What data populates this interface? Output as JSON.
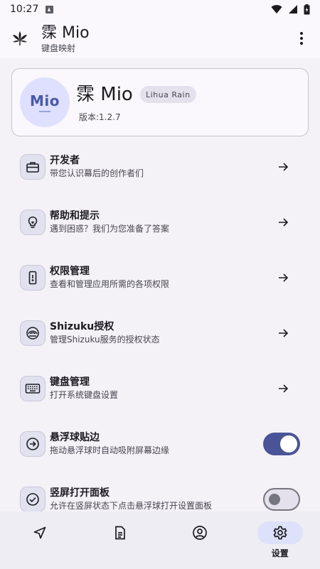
{
  "status_bar": {
    "time": "10:27"
  },
  "app_bar": {
    "title": "霂 Mio",
    "subtitle": "键盘映射"
  },
  "about": {
    "avatar_text": "Mio",
    "name": "霂 Mio",
    "author": "Lihua Rain",
    "version": "版本:1.2.7"
  },
  "settings": {
    "items": [
      {
        "label": "开发者",
        "desc": "带您认识幕后的创作者们",
        "icon": "briefcase-icon",
        "trailing": "arrow"
      },
      {
        "label": "帮助和提示",
        "desc": "遇到困惑？我们为您准备了答案",
        "icon": "lightbulb-icon",
        "trailing": "arrow"
      },
      {
        "label": "权限管理",
        "desc": "查看和管理应用所需的各项权限",
        "icon": "phone-icon",
        "trailing": "arrow"
      },
      {
        "label": "Shizuku授权",
        "desc": "管理Shizuku服务的授权状态",
        "icon": "shizuku-icon",
        "trailing": "arrow"
      },
      {
        "label": "键盘管理",
        "desc": "打开系统键盘设置",
        "icon": "keyboard-icon",
        "trailing": "arrow"
      },
      {
        "label": "悬浮球贴边",
        "desc": "拖动悬浮球时自动吸附屏幕边缘",
        "icon": "arrow-circle-icon",
        "trailing": "toggle",
        "toggle_on": true
      },
      {
        "label": "竖屏打开面板",
        "desc": "允许在竖屏状态下点击悬浮球打开设置面板",
        "icon": "check-circle-icon",
        "trailing": "toggle",
        "toggle_on": false
      }
    ]
  },
  "bottom_nav": {
    "items": [
      {
        "icon": "send-icon",
        "label": "",
        "active": false
      },
      {
        "icon": "document-icon",
        "label": "",
        "active": false
      },
      {
        "icon": "account-icon",
        "label": "",
        "active": false
      },
      {
        "icon": "gear-icon",
        "label": "设置",
        "active": true
      }
    ]
  },
  "colors": {
    "accent": "#4a5597",
    "background": "#fbf8fd",
    "content_bg": "#f4f1f7",
    "icon_box": "#e2e1ef",
    "avatar_bg": "#dfe0ff"
  }
}
